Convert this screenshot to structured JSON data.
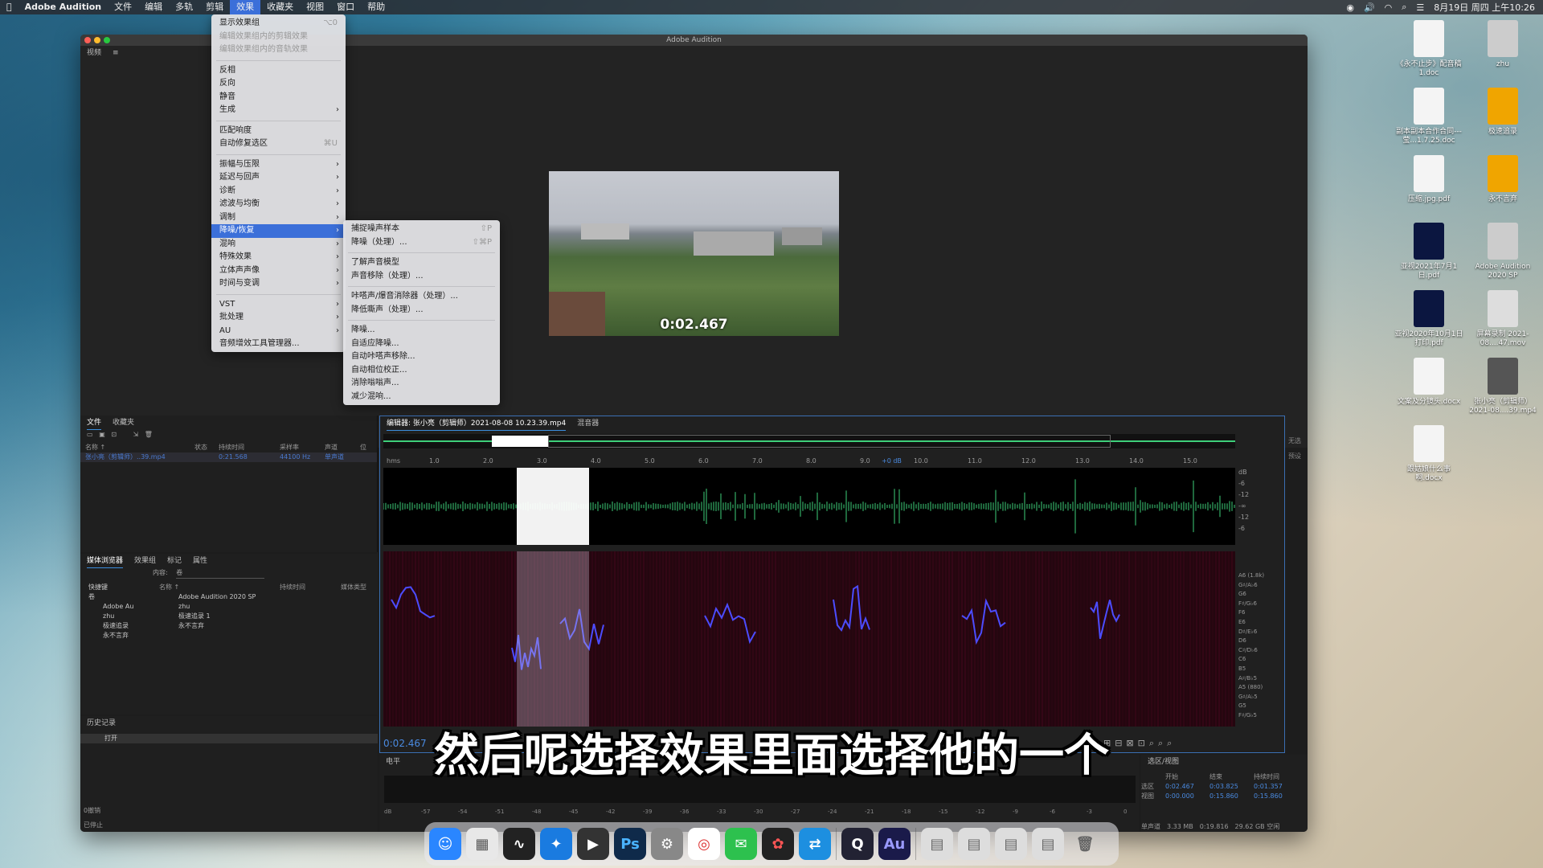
{
  "menubar": {
    "apple": "",
    "app": "Adobe Audition",
    "items": [
      "文件",
      "编辑",
      "多轨",
      "剪辑",
      "效果",
      "收藏夹",
      "视图",
      "窗口",
      "帮助"
    ],
    "clock": "8月19日 周四 上午10:26"
  },
  "window": {
    "title": "Adobe Audition"
  },
  "video": {
    "panel_label": "视频",
    "time": "0:02.467"
  },
  "effects_menu": {
    "items": [
      {
        "label": "显示效果组",
        "shortcut": "⌥0",
        "enabled": true
      },
      {
        "label": "编辑效果组内的剪辑效果",
        "enabled": false
      },
      {
        "label": "编辑效果组内的音轨效果",
        "enabled": false
      },
      {
        "sep": true
      },
      {
        "label": "反相",
        "enabled": true
      },
      {
        "label": "反向",
        "enabled": true
      },
      {
        "label": "静音",
        "enabled": true
      },
      {
        "label": "生成",
        "arrow": true,
        "enabled": true
      },
      {
        "sep": true
      },
      {
        "label": "匹配响度",
        "enabled": true
      },
      {
        "label": "自动修复选区",
        "shortcut": "⌘U",
        "enabled": true
      },
      {
        "sep": true
      },
      {
        "label": "振幅与压限",
        "arrow": true,
        "enabled": true
      },
      {
        "label": "延迟与回声",
        "arrow": true,
        "enabled": true
      },
      {
        "label": "诊断",
        "arrow": true,
        "enabled": true
      },
      {
        "label": "滤波与均衡",
        "arrow": true,
        "enabled": true
      },
      {
        "label": "调制",
        "arrow": true,
        "enabled": true
      },
      {
        "label": "降噪/恢复",
        "arrow": true,
        "enabled": true,
        "highlight": true
      },
      {
        "label": "混响",
        "arrow": true,
        "enabled": true
      },
      {
        "label": "特殊效果",
        "arrow": true,
        "enabled": true
      },
      {
        "label": "立体声声像",
        "arrow": true,
        "enabled": true
      },
      {
        "label": "时间与变调",
        "arrow": true,
        "enabled": true
      },
      {
        "sep": true
      },
      {
        "label": "VST",
        "arrow": true,
        "enabled": true
      },
      {
        "label": "批处理",
        "arrow": true,
        "enabled": true
      },
      {
        "label": "AU",
        "arrow": true,
        "enabled": true
      },
      {
        "label": "音频增效工具管理器...",
        "enabled": true
      }
    ]
  },
  "noise_menu": {
    "items": [
      {
        "label": "捕捉噪声样本",
        "shortcut": "⇧P"
      },
      {
        "label": "降噪（处理）...",
        "shortcut": "⇧⌘P"
      },
      {
        "sep": true
      },
      {
        "label": "了解声音模型"
      },
      {
        "label": "声音移除（处理）..."
      },
      {
        "sep": true
      },
      {
        "label": "咔嗒声/爆音消除器（处理）..."
      },
      {
        "label": "降低嘶声（处理）..."
      },
      {
        "sep": true
      },
      {
        "label": "降噪..."
      },
      {
        "label": "自适应降噪..."
      },
      {
        "label": "自动咔嗒声移除..."
      },
      {
        "label": "自动相位校正..."
      },
      {
        "label": "消除嗡嗡声..."
      },
      {
        "label": "减少混响..."
      }
    ]
  },
  "files_panel": {
    "tabs": [
      "文件",
      "收藏夹"
    ],
    "columns": [
      "名称 ↑",
      "状态",
      "持续时间",
      "采样率",
      "声道",
      "位"
    ],
    "row": {
      "name": "张小亮（剪辑师）..39.mp4",
      "duration": "0:21.568",
      "rate": "44100 Hz",
      "channels": "单声道"
    }
  },
  "media_panel": {
    "tabs": [
      "媒体浏览器",
      "效果组",
      "标记",
      "属性"
    ],
    "content_label": "内容:",
    "content_value": "卷",
    "tree": [
      "快捷键",
      "卷",
      "Adobe Au",
      "zhu",
      "极速追录",
      "永不言弃"
    ],
    "columns": [
      "名称 ↑",
      "持续时间",
      "媒体类型"
    ],
    "list": [
      "Adobe Audition 2020 SP",
      "zhu",
      "极速追录 1",
      "永不言弃"
    ]
  },
  "history_panel": {
    "title": "历史记录",
    "item": "打开",
    "undo": "0撤销",
    "status": "已停止"
  },
  "editor": {
    "tab": "编辑器: 张小亮（剪辑师）2021-08-08 10.23.39.mp4",
    "tab2": "混音器",
    "ruler": [
      "hms",
      "1.0",
      "2.0",
      "3.0",
      "4.0",
      "5.0",
      "6.0",
      "7.0",
      "8.0",
      "9.0",
      "10.0",
      "11.0",
      "12.0",
      "13.0",
      "14.0",
      "15.0"
    ],
    "gain": "+0 dB",
    "db_scale": [
      "dB",
      "-6",
      "-12",
      "-∞",
      "-12",
      "-6"
    ],
    "notes": [
      "A6 (1.8k)",
      "G♯/A♭6",
      "G6",
      "F♯/G♭6",
      "F6",
      "E6",
      "D♯/E♭6",
      "D6",
      "C♯/D♭6",
      "C6",
      "B5",
      "A♯/B♭5",
      "A5 (880)",
      "G♯/A♭5",
      "G5",
      "F♯/G♭5"
    ],
    "current_time": "0:02.467"
  },
  "level_panel": {
    "title": "电平",
    "scale": [
      "dB",
      "-57",
      "-54",
      "-51",
      "-48",
      "-45",
      "-42",
      "-39",
      "-36",
      "-33",
      "-30",
      "-27",
      "-24",
      "-21",
      "-18",
      "-15",
      "-12",
      "-9",
      "-6",
      "-3",
      "0"
    ]
  },
  "selview": {
    "title": "选区/视图",
    "headers": [
      "开始",
      "结束",
      "持续时间"
    ],
    "selection": {
      "label": "选区",
      "start": "0:02.467",
      "end": "0:03.825",
      "duration": "0:01.357"
    },
    "view": {
      "label": "视图",
      "start": "0:00.000",
      "end": "0:15.860",
      "duration": "0:15.860"
    }
  },
  "status_bar": {
    "channel": "单声道",
    "size": "3.33 MB",
    "duration": "0:19.816",
    "free": "29.62 GB 空闲"
  },
  "right_strip": {
    "label1": "无选",
    "label2": "预设"
  },
  "desktop_icons": [
    {
      "label": "《永不止步》配音稿 1.doc"
    },
    {
      "label": "zhu"
    },
    {
      "label": "副本副本合作合同---莹...1.7.25.doc"
    },
    {
      "label": "极速追录"
    },
    {
      "label": "压缩.jpg.pdf"
    },
    {
      "label": "永不言弃"
    },
    {
      "label": "亚视2021年7月1日.pdf"
    },
    {
      "label": "Adobe Audition 2020 SP"
    },
    {
      "label": "亚视2020年10月1日打印.pdf"
    },
    {
      "label": "屏幕录制 2021-08....47.mov"
    },
    {
      "label": "文案及分镜头.docx"
    },
    {
      "label": "张小亮（剪辑师）2021-08....39.mp4"
    },
    {
      "label": "跟姑娘什么事啊.docx"
    }
  ],
  "subtitle": "然后呢选择效果里面选择他的一个",
  "colors": {
    "waveform": "#3ecf7a",
    "accent": "#3b6fd9",
    "spectral": "#3a0a2a"
  }
}
